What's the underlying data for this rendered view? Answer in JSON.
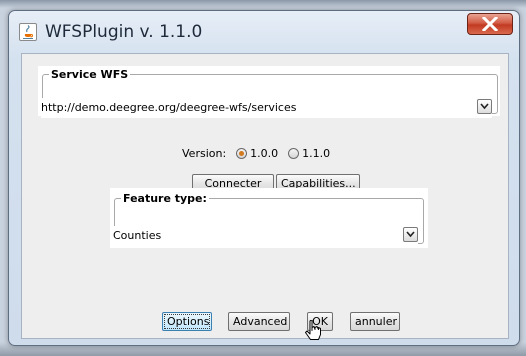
{
  "window": {
    "title": "WFSPlugin v. 1.1.0",
    "close_label": "close"
  },
  "service": {
    "legend": "Service WFS",
    "url": "http://demo.deegree.org/deegree-wfs/services"
  },
  "version": {
    "label": "Version:",
    "options": [
      {
        "label": "1.0.0",
        "selected": true
      },
      {
        "label": "1.1.0",
        "selected": false
      }
    ]
  },
  "actions": {
    "connect": "Connecter",
    "capabilities": "Capabilities..."
  },
  "feature": {
    "legend": "Feature type:",
    "value": "Counties"
  },
  "footer": {
    "options": "Options",
    "advanced": "Advanced",
    "ok": "OK",
    "cancel": "annuler"
  },
  "colors": {
    "radio_selected": "#d27a1e",
    "close_button": "#c23a22",
    "titlebar": "#d4e1ef"
  }
}
